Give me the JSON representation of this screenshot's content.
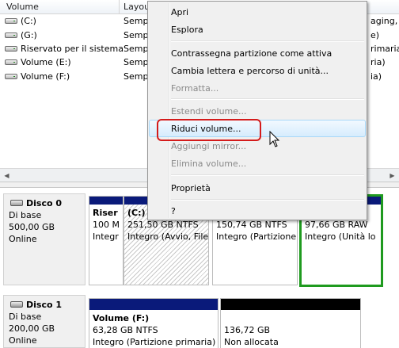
{
  "list": {
    "columns": [
      "Volume",
      "Layout"
    ],
    "rows": [
      {
        "name": "(C:)",
        "layout": "Semp",
        "tail": "aging, Da"
      },
      {
        "name": "(G:)",
        "layout": "Semp",
        "tail": "e)"
      },
      {
        "name": "Riservato per il sistema",
        "layout": "Semp",
        "tail": "rimaria)"
      },
      {
        "name": "Volume (E:)",
        "layout": "Semp",
        "tail": "ria)"
      },
      {
        "name": "Volume (F:)",
        "layout": "Semp",
        "tail": "ia)"
      }
    ]
  },
  "context_menu": {
    "items": [
      {
        "label": "Apri",
        "enabled": true
      },
      {
        "label": "Esplora",
        "enabled": true
      },
      {
        "label": "Contrassegna partizione come attiva",
        "enabled": true
      },
      {
        "label": "Cambia lettera e percorso di unità...",
        "enabled": true
      },
      {
        "label": "Formatta...",
        "enabled": false
      },
      {
        "label": "Estendi volume...",
        "enabled": false
      },
      {
        "label": "Riduci volume...",
        "enabled": true,
        "highlighted": true
      },
      {
        "label": "Aggiungi mirror...",
        "enabled": false
      },
      {
        "label": "Elimina volume...",
        "enabled": false
      },
      {
        "label": "Proprietà",
        "enabled": true
      },
      {
        "label": "?",
        "enabled": true
      }
    ]
  },
  "disks": [
    {
      "title": "Disco 0",
      "type": "Di base",
      "size": "500,00 GB",
      "status": "Online",
      "partitions": [
        {
          "name": "Riser",
          "size": "100 M",
          "status": "Integr"
        },
        {
          "name": "(C:)",
          "size": "251,50 GB NTFS",
          "status": "Integro (Avvio, File"
        },
        {
          "name": "",
          "size": "150,74 GB NTFS",
          "status": "Integro (Partizione"
        },
        {
          "name": "",
          "size": "97,66 GB RAW",
          "status": "Integro (Unità lo"
        }
      ]
    },
    {
      "title": "Disco 1",
      "type": "Di base",
      "size": "200,00 GB",
      "status": "Online",
      "partitions": [
        {
          "name": "Volume  (F:)",
          "size": "63,28 GB NTFS",
          "status": "Integro (Partizione primaria)"
        },
        {
          "name": "",
          "size": "136,72 GB",
          "status": "Non allocata"
        }
      ]
    }
  ],
  "colors": {
    "primary_partition": "#0a1a7a",
    "unallocated": "#000000",
    "selected_partition_border": "#1f9a1f",
    "callout": "#d41b1b",
    "menu_highlight": "#d6ecfd"
  }
}
